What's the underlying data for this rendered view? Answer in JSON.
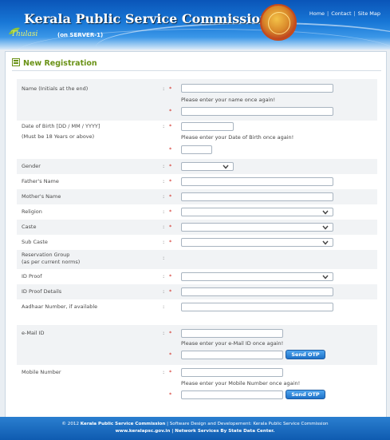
{
  "header": {
    "title": "Kerala Public Service Commission",
    "logo_word": "Thulasi",
    "server": "(on SERVER-1)",
    "links": [
      "Home",
      "Contact",
      "Site Map"
    ]
  },
  "section": {
    "title": "New Registration"
  },
  "form": {
    "name_label": "Name (Initials at the end)",
    "name_hint": "Please enter your name once again!",
    "dob_label": "Date of Birth [DD / MM / YYYY]",
    "dob_note": "(Must be 18 Years or above)",
    "dob_hint": "Please enter your Date of Birth once again!",
    "gender_label": "Gender",
    "father_label": "Father's Name",
    "mother_label": "Mother's Name",
    "religion_label": "Religion",
    "caste_label": "Caste",
    "subcaste_label": "Sub Caste",
    "reservation_label_1": "Reservation Group",
    "reservation_label_2": "(as per current norms)",
    "idproof_label": "ID Proof",
    "idproof_details_label": "ID Proof Details",
    "aadhaar_label": "Aadhaar Number, if available",
    "email_label": "e-Mail ID",
    "email_hint": "Please enter your e-Mail ID once again!",
    "mobile_label": "Mobile Number",
    "mobile_hint": "Please enter your Mobile Number once again!",
    "send_otp": "Send OTP",
    "colon": ":",
    "required": "*"
  },
  "footer": {
    "line1_a": "© 2012 ",
    "line1_b": "Kerala Public Service Commission",
    "line1_c": " | Software Design and Developement: Kerala Public Service Commission",
    "line2": "www.keralapsc.gov.in | Network Services By State Data Center."
  },
  "colors": {
    "header_blue": "#1877d6",
    "section_green": "#6a9216",
    "required_red": "#d0241b",
    "button_blue": "#1f72c8"
  }
}
